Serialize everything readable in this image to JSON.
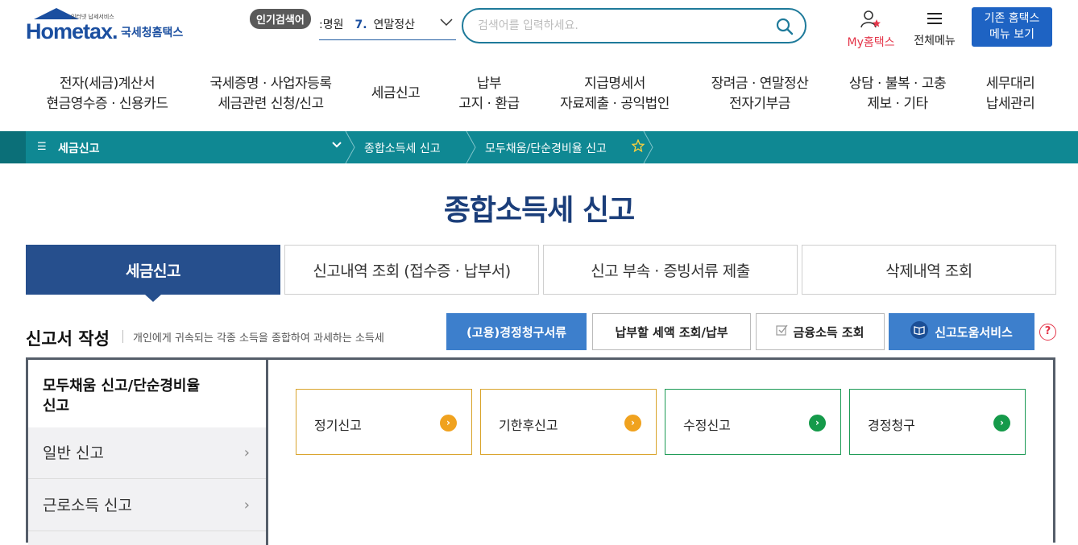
{
  "header": {
    "logo": {
      "tagline": "인터넷 납세서비스",
      "brand": "Hometax.",
      "korean_name": "국세청홈택스"
    },
    "popular": {
      "badge": "인기검색어",
      "prefix": ":명원",
      "rank": "7.",
      "keyword": "연말정산"
    },
    "search": {
      "placeholder": "검색어를 입력하세요."
    },
    "my_hometax": "My홈택스",
    "all_menu": "전체메뉴",
    "legacy_menu": {
      "line1": "기존 홈택스",
      "line2": "메뉴 보기"
    }
  },
  "gnb": [
    {
      "line1": "전자(세금)계산서",
      "line2": "현금영수증 · 신용카드"
    },
    {
      "line1": "국세증명 · 사업자등록",
      "line2": "세금관련 신청/신고"
    },
    {
      "line1": "세금신고",
      "line2": ""
    },
    {
      "line1": "납부",
      "line2": "고지 · 환급"
    },
    {
      "line1": "지급명세서",
      "line2": "자료제출 · 공익법인"
    },
    {
      "line1": "장려금 · 연말정산",
      "line2": "전자기부금"
    },
    {
      "line1": "상담 · 불복 · 고충",
      "line2": "제보 · 기타"
    },
    {
      "line1": "세무대리",
      "line2": "납세관리"
    }
  ],
  "breadcrumb": {
    "home": "세금신고",
    "level1": "종합소득세 신고",
    "level2": "모두채움/단순경비율 신고"
  },
  "page_title": "종합소득세 신고",
  "tabs": [
    "세금신고",
    "신고내역 조회 (접수증 · 납부서)",
    "신고 부속 · 증빙서류 제출",
    "삭제내역 조회"
  ],
  "section": {
    "title": "신고서 작성",
    "description": "개인에게 귀속되는 각종 소득을 종합하여 과세하는 소득세",
    "buttons": {
      "correction": "(고용)경정청구서류",
      "tax_payable": "납부할 세액 조회/납부",
      "financial": "금융소득 조회",
      "help_service": "신고도움서비스"
    },
    "help": "?"
  },
  "side_menu": {
    "active_line1": "모두채움 신고/단순경비율",
    "active_line2": "신고",
    "item2": "일반 신고",
    "item3": "근로소득 신고"
  },
  "options": [
    "정기신고",
    "기한후신고",
    "수정신고",
    "경정청구"
  ],
  "colors": {
    "teal_bar": "#0f8893",
    "navy": "#264f8d",
    "blue_button": "#3d7fcc",
    "orange": "#f0a21f",
    "green": "#159a4a",
    "red": "#e4364a"
  }
}
